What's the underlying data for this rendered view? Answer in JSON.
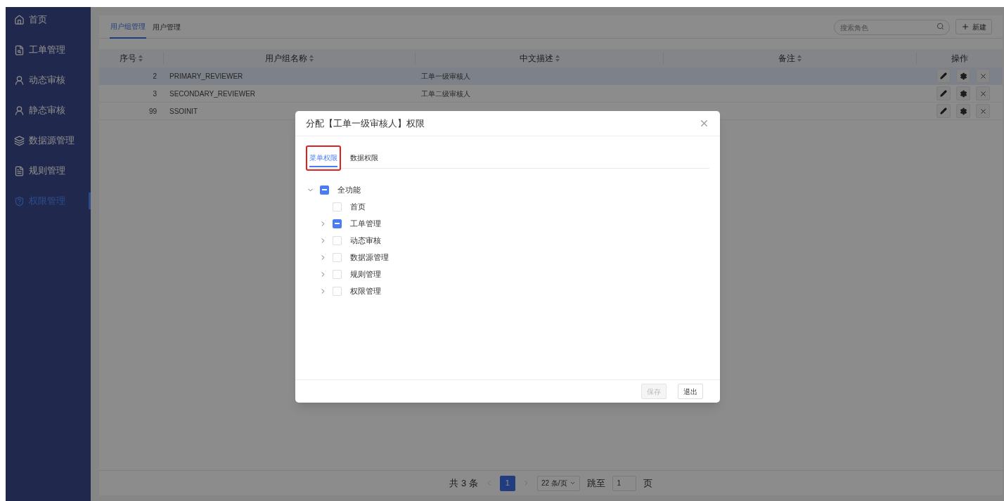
{
  "sidebar": {
    "items": [
      {
        "label": "首页",
        "selected": false
      },
      {
        "label": "工单管理",
        "selected": false
      },
      {
        "label": "动态审核",
        "selected": false
      },
      {
        "label": "静态审核",
        "selected": false
      },
      {
        "label": "数据源管理",
        "selected": false
      },
      {
        "label": "规则管理",
        "selected": false
      },
      {
        "label": "权限管理",
        "selected": true
      }
    ]
  },
  "tabs": [
    {
      "label": "用户组管理",
      "selected": true
    },
    {
      "label": "用户管理",
      "selected": false
    }
  ],
  "search": {
    "placeholder": "搜索角色"
  },
  "new_button": "新建",
  "table": {
    "columns": [
      "序号",
      "用户组名称",
      "中文描述",
      "备注",
      "操作"
    ],
    "rows": [
      {
        "cells": [
          "2",
          "PRIMARY_REVIEWER",
          "工单一级审核人",
          ""
        ],
        "selected": true
      },
      {
        "cells": [
          "3",
          "SECONDARY_REVIEWER",
          "工单二级审核人",
          ""
        ],
        "selected": false
      },
      {
        "cells": [
          "99",
          "SSOINIT",
          "",
          ""
        ],
        "selected": false
      }
    ]
  },
  "pagination": {
    "total": "共 3 条",
    "pages": [
      {
        "label": "1",
        "selected": true
      }
    ],
    "page_size": "22 条/页",
    "jump_label": "跳至",
    "jump_value": "1",
    "page_suffix": "页"
  },
  "dialog": {
    "title": "分配【工单一级审核人】权限",
    "tabs": [
      {
        "label": "菜单权限",
        "selected": true,
        "highlighted": true
      },
      {
        "label": "数据权限",
        "selected": false,
        "highlighted": false
      }
    ],
    "tree": [
      {
        "label": "全功能",
        "indeterminate": true,
        "expanded": true,
        "children": [
          {
            "label": "首页",
            "checked": false,
            "indeterminate": false
          },
          {
            "label": "工单管理",
            "indeterminate": true,
            "expanded": false
          },
          {
            "label": "动态审核",
            "checked": false,
            "indeterminate": false,
            "expanded": false
          },
          {
            "label": "数据源管理",
            "checked": false,
            "indeterminate": false,
            "expanded": false
          },
          {
            "label": "规则管理",
            "checked": false,
            "indeterminate": false,
            "expanded": false
          },
          {
            "label": "权限管理",
            "checked": false,
            "indeterminate": false,
            "expanded": false
          }
        ]
      }
    ],
    "buttons": [
      {
        "label": "保存",
        "disabled": true
      },
      {
        "label": "退出",
        "disabled": false
      }
    ]
  }
}
